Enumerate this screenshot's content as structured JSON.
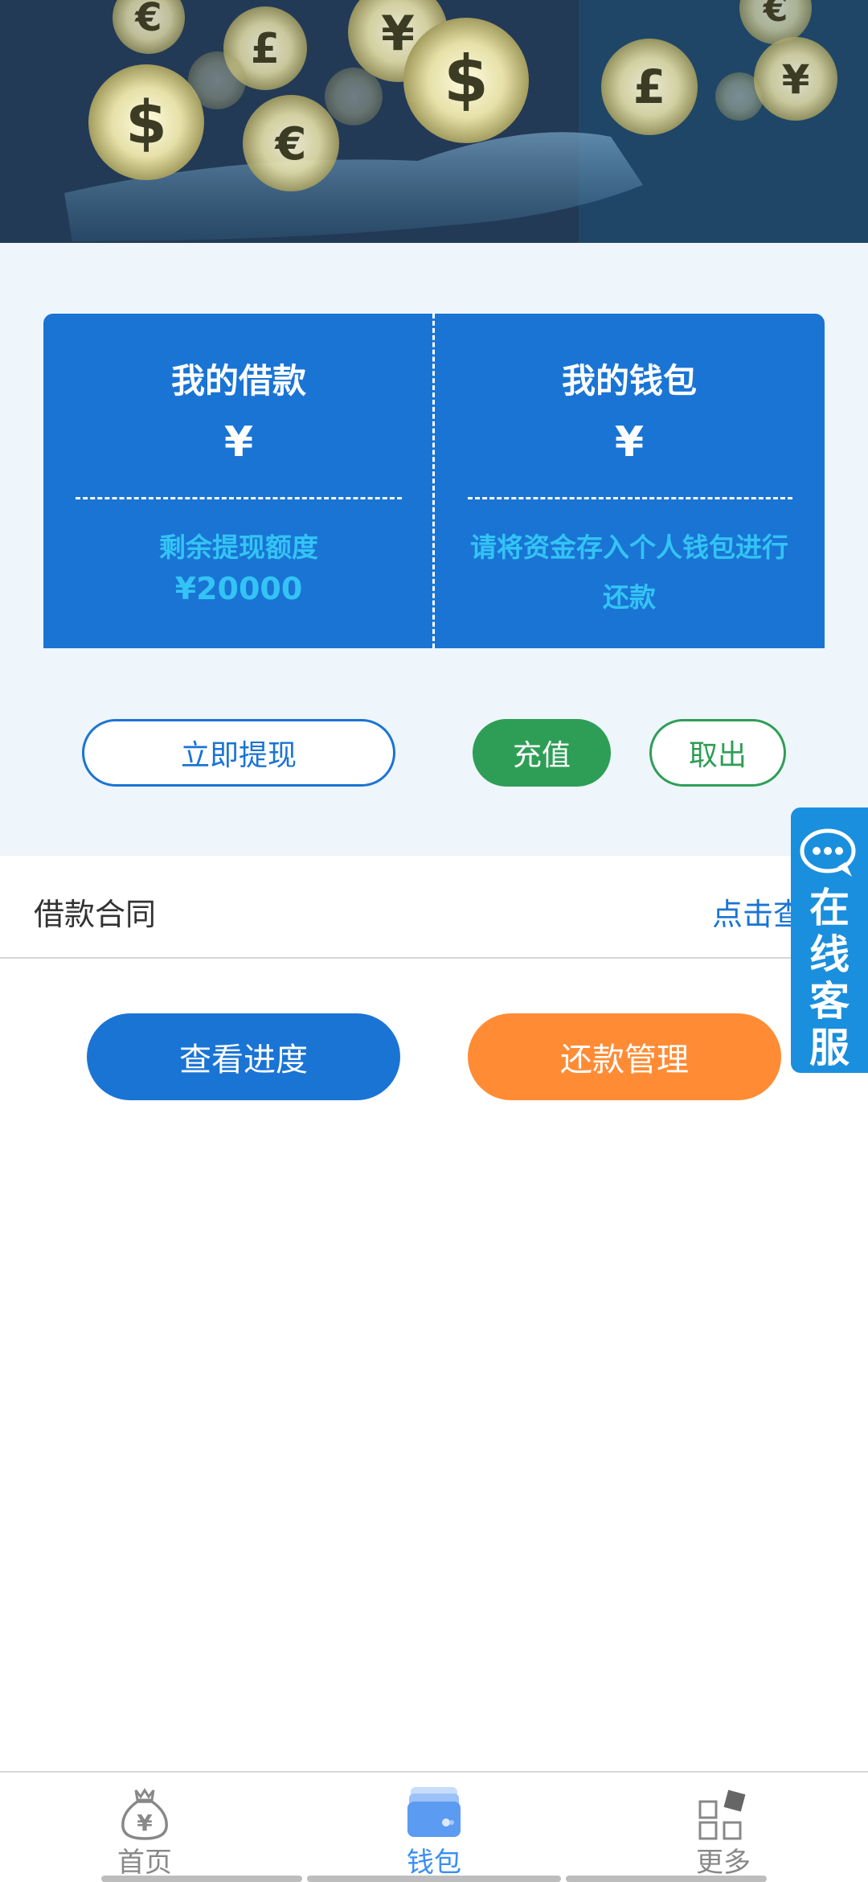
{
  "cards": {
    "loan": {
      "title": "我的借款",
      "symbol": "¥",
      "sub": "剩余提现额度",
      "amount": "¥20000"
    },
    "wallet": {
      "title": "我的钱包",
      "symbol": "¥",
      "sub": "请将资金存入个人钱包进行还款"
    }
  },
  "actions": {
    "withdraw": "立即提现",
    "recharge": "充值",
    "takeout": "取出"
  },
  "contract": {
    "label": "借款合同",
    "link": "点击查"
  },
  "buttons": {
    "progress": "查看进度",
    "repay": "还款管理"
  },
  "service": {
    "label": "在线客服"
  },
  "colors": {
    "primary": "#1a74d4",
    "green": "#2e9e56",
    "orange": "#ff8c35",
    "tab_active": "#3a8ef5"
  },
  "tabbar": {
    "items": [
      {
        "label": "首页",
        "icon": "money-bag-icon"
      },
      {
        "label": "钱包",
        "icon": "wallet-icon",
        "active": true
      },
      {
        "label": "更多",
        "icon": "grid-icon"
      }
    ]
  }
}
